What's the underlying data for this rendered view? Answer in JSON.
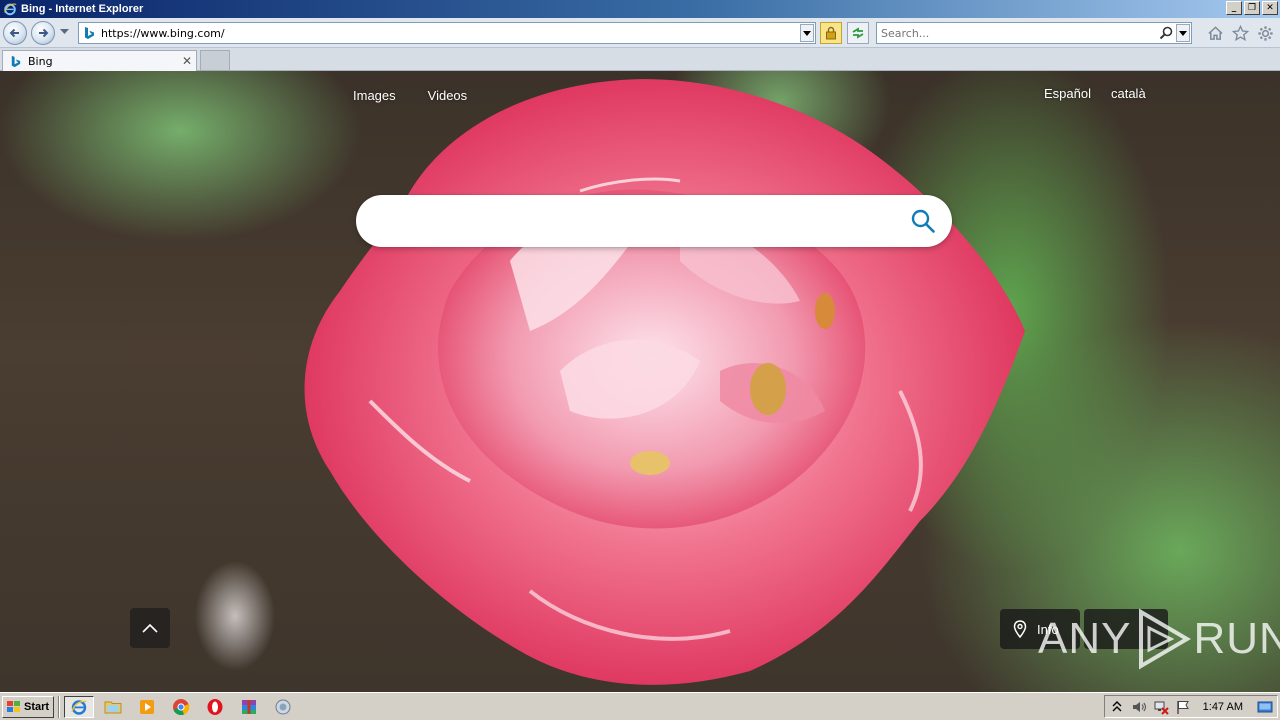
{
  "window": {
    "title": "Bing - Internet Explorer",
    "minimize": "_",
    "restore": "❐",
    "close": "✕"
  },
  "navbar": {
    "url": "https://www.bing.com/",
    "search_placeholder": "Search..."
  },
  "tab": {
    "label": "Bing",
    "close": "✕"
  },
  "bing": {
    "nav_left": [
      "Images",
      "Videos"
    ],
    "nav_right": [
      "Español",
      "català"
    ],
    "search_value": "",
    "info_label": "Info"
  },
  "watermark": {
    "text": "RUN",
    "prefix": "ANY"
  },
  "taskbar": {
    "start_label": "Start",
    "clock": "1:47 AM"
  },
  "colors": {
    "bing_blue": "#0f7cb5",
    "titlebar": "#0a246a",
    "flower_pink": "#e8305e"
  }
}
